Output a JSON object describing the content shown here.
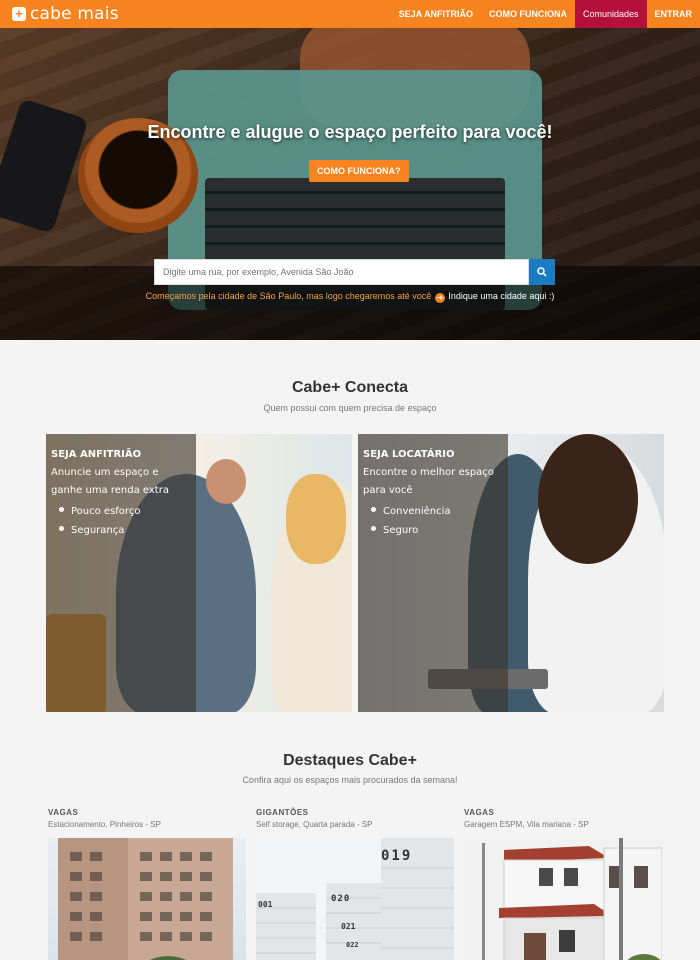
{
  "brand": {
    "logo_text": "cabe mais",
    "logo_mark": "+",
    "accent": "#f7841f",
    "active_nav_color": "#b4103b"
  },
  "nav": {
    "items": [
      {
        "label": "SEJA ANFITRIÃO"
      },
      {
        "label": "COMO FUNCIONA"
      },
      {
        "label": "Comunidades"
      },
      {
        "label": "ENTRAR"
      }
    ]
  },
  "hero": {
    "title": "Encontre e alugue o espaço perfeito para você!",
    "button": "COMO FUNCIONA?",
    "search_placeholder": "Digite uma rua, por exemplo, Avenida São João",
    "note": "Começamos pela cidade de São Paulo, mas logo chegaremos até você",
    "note_link": "Indique uma cidade aqui :)",
    "search_icon": "search-icon",
    "arrow_icon": "arrow-right-circle-icon"
  },
  "conecta": {
    "title": "Cabe+ Conecta",
    "subtitle": "Quem possui com quem precisa de espaço",
    "cards": [
      {
        "heading": "SEJA ANFITRIÃO",
        "desc": "Anuncie um espaço e ganhe uma renda extra",
        "bullets": [
          "Pouco esforço",
          "Segurança"
        ]
      },
      {
        "heading": "SEJA LOCATÁRIO",
        "desc": "Encontre o melhor espaço para você",
        "bullets": [
          "Conveniência",
          "Seguro"
        ]
      }
    ]
  },
  "destaques": {
    "title": "Destaques Cabe+",
    "subtitle": "Confira aqui os espaços mais procurados da semana!",
    "items": [
      {
        "category": "VAGAS",
        "location": "Estacionamento, Pinheiros - SP"
      },
      {
        "category": "GIGANTÕES",
        "location": "Self storage, Quarta parada - SP",
        "unit_numbers": [
          "019",
          "020",
          "021",
          "001",
          "022"
        ]
      },
      {
        "category": "VAGAS",
        "location": "Garagem ESPM, Vila mariana - SP"
      }
    ]
  }
}
